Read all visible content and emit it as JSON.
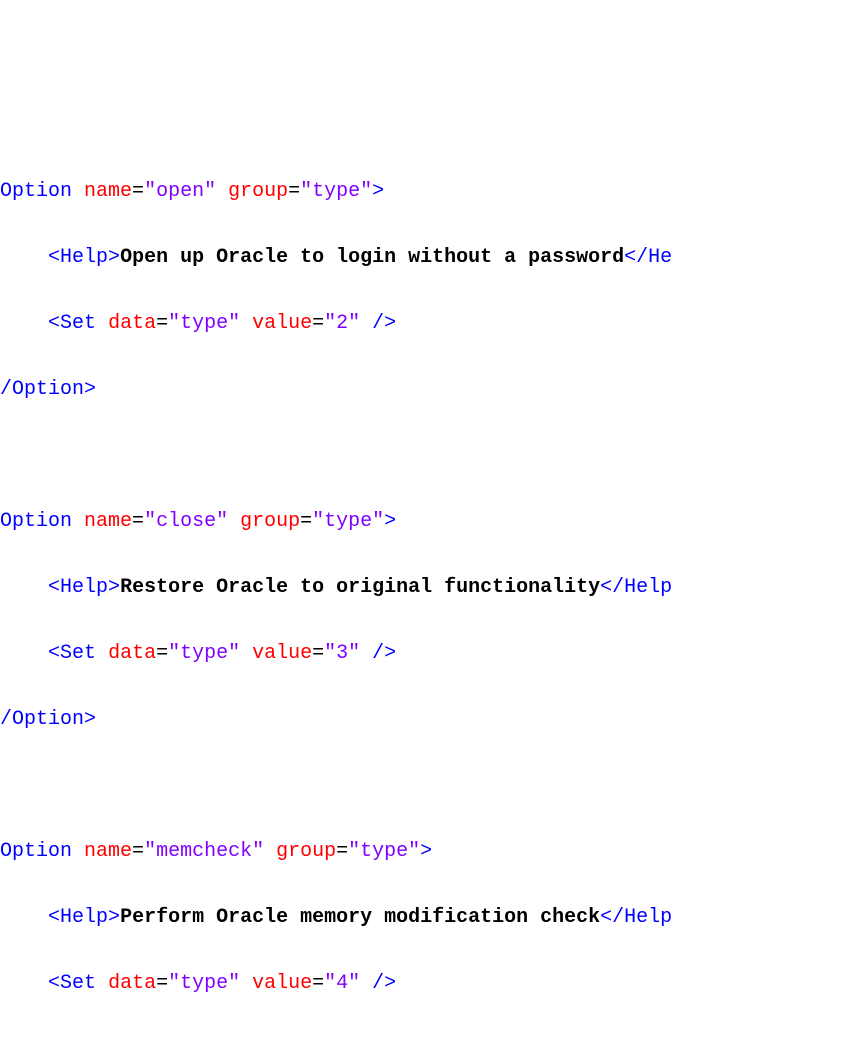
{
  "code": {
    "option1": {
      "tag_open": "Option",
      "name_attr": "name",
      "name_val": "\"open\"",
      "group_attr": "group",
      "group_val": "\"type\"",
      "help_tag": "Help",
      "help_text": "Open up Oracle to login without a password",
      "help_close": "/He",
      "set_tag": "Set",
      "data_attr": "data",
      "data_val": "\"type\"",
      "value_attr": "value",
      "value_val": "\"2\"",
      "option_close": "/Option",
      "lt": "<",
      "gt": ">",
      "eq": "=",
      "sp": " ",
      "slash_close": " />"
    },
    "option2": {
      "tag_open": "Option",
      "name_attr": "name",
      "name_val": "\"close\"",
      "group_attr": "group",
      "group_val": "\"type\"",
      "help_tag": "Help",
      "help_text": "Restore Oracle to original functionality",
      "help_close": "/Help",
      "set_tag": "Set",
      "data_attr": "data",
      "data_val": "\"type\"",
      "value_attr": "value",
      "value_val": "\"3\"",
      "option_close": "/Option",
      "lt": "<",
      "gt": ">",
      "eq": "=",
      "sp": " ",
      "slash_close": " />"
    },
    "option3": {
      "tag_open": "Option",
      "name_attr": "name",
      "name_val": "\"memcheck\"",
      "group_attr": "group",
      "group_val": "\"type\"",
      "help_tag": "Help",
      "help_text": "Perform Oracle memory modification check",
      "help_close": "/Help",
      "set_tag": "Set",
      "data_attr": "data",
      "data_val": "\"type\"",
      "value_attr": "value",
      "value_val": "\"4\"",
      "lt": "<",
      "gt": ">",
      "eq": "=",
      "sp": " ",
      "slash_close": " />"
    },
    "indent": "    "
  }
}
